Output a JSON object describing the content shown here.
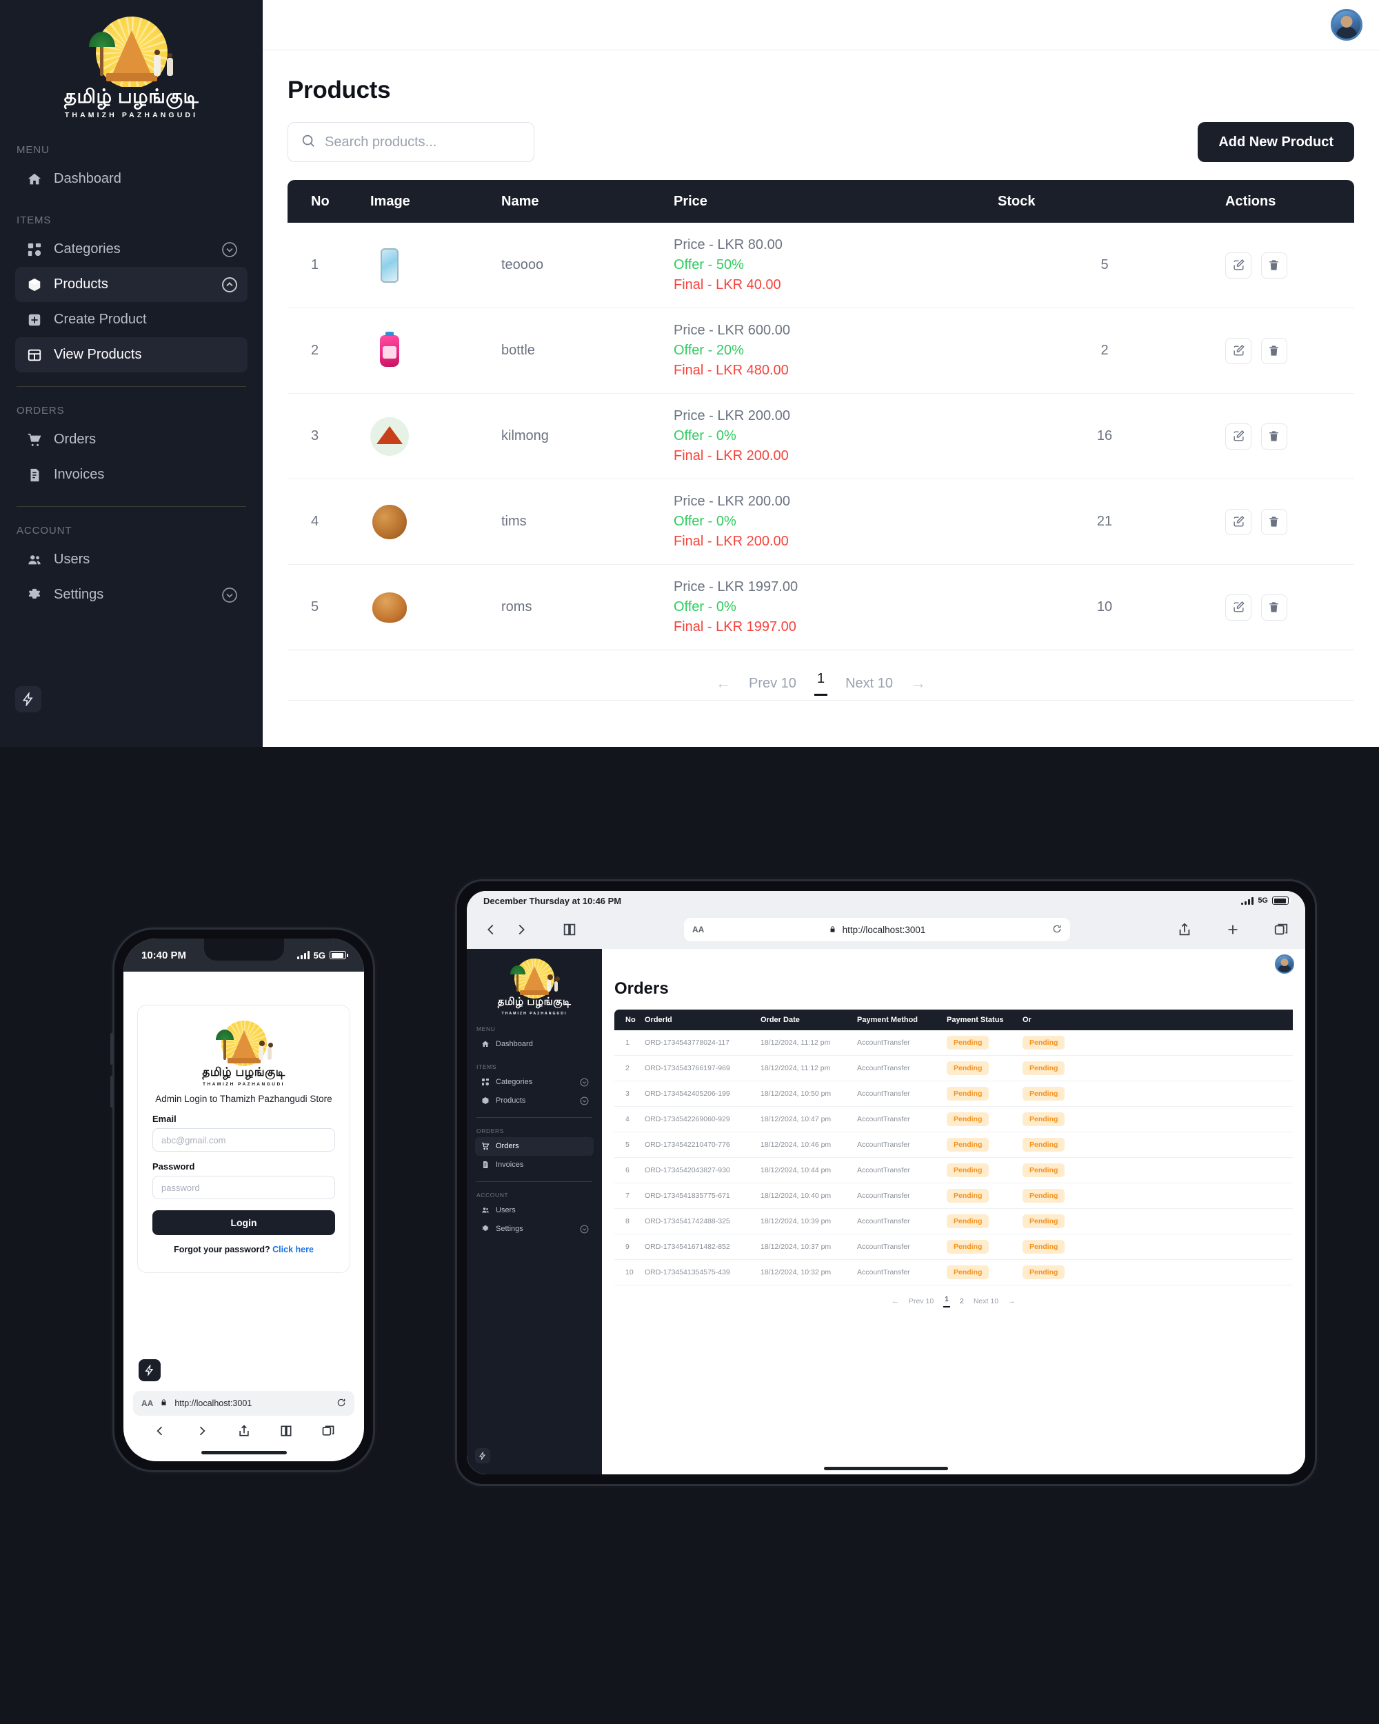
{
  "brand": {
    "tamil_name": "தமிழ் பழங்குடி",
    "latin_name": "THAMIZH PAZHANGUDI"
  },
  "desktop": {
    "sidebar": {
      "sections": [
        {
          "label": "MENU",
          "items": [
            {
              "label": "Dashboard",
              "icon": "home-icon",
              "active": false,
              "chevron": "none"
            }
          ]
        },
        {
          "label": "ITEMS",
          "items": [
            {
              "label": "Categories",
              "icon": "grid-icon",
              "active": false,
              "chevron": "down"
            },
            {
              "label": "Products",
              "icon": "box-icon",
              "active": true,
              "chevron": "up"
            },
            {
              "label": "Create Product",
              "icon": "plus-square-icon",
              "active": false,
              "chevron": "none"
            },
            {
              "label": "View Products",
              "icon": "table-icon",
              "active": true,
              "chevron": "none"
            }
          ]
        },
        {
          "label": "ORDERS",
          "items": [
            {
              "label": "Orders",
              "icon": "cart-icon",
              "active": false,
              "chevron": "none"
            },
            {
              "label": "Invoices",
              "icon": "invoice-icon",
              "active": false,
              "chevron": "none"
            }
          ]
        },
        {
          "label": "ACCOUNT",
          "items": [
            {
              "label": "Users",
              "icon": "users-icon",
              "active": false,
              "chevron": "none"
            },
            {
              "label": "Settings",
              "icon": "gear-icon",
              "active": false,
              "chevron": "down"
            }
          ]
        }
      ]
    },
    "page_title": "Products",
    "search_placeholder": "Search products...",
    "add_button": "Add New Product",
    "table": {
      "headers": [
        "No",
        "Image",
        "Name",
        "Price",
        "Stock",
        "Actions"
      ],
      "rows": [
        {
          "no": "1",
          "image": "phone-thumbnail",
          "name": "teoooo",
          "price": "Price - LKR 80.00",
          "offer": "Offer - 50%",
          "final": "Final - LKR 40.00",
          "stock": "5"
        },
        {
          "no": "2",
          "image": "bottle-thumbnail",
          "name": "bottle",
          "price": "Price - LKR 600.00",
          "offer": "Offer - 20%",
          "final": "Final - LKR 480.00",
          "stock": "2"
        },
        {
          "no": "3",
          "image": "spice-thumbnail",
          "name": "kilmong",
          "price": "Price - LKR 200.00",
          "offer": "Offer - 0%",
          "final": "Final - LKR 200.00",
          "stock": "16"
        },
        {
          "no": "4",
          "image": "cookie-thumbnail",
          "name": "tims",
          "price": "Price - LKR 200.00",
          "offer": "Offer - 0%",
          "final": "Final - LKR 200.00",
          "stock": "21"
        },
        {
          "no": "5",
          "image": "bread-thumbnail",
          "name": "roms",
          "price": "Price - LKR 1997.00",
          "offer": "Offer - 0%",
          "final": "Final - LKR 1997.00",
          "stock": "10"
        }
      ]
    },
    "pagination": {
      "prev": "Prev 10",
      "pages": [
        "1"
      ],
      "next": "Next 10"
    },
    "colors": {
      "offer": "#2ecc5e",
      "final": "#f4443c",
      "dark": "#1b1f2a"
    }
  },
  "phone": {
    "status": {
      "time": "10:40 PM",
      "network": "5G"
    },
    "login": {
      "subtitle": "Admin Login to Thamizh Pazhangudi Store",
      "email_label": "Email",
      "email_placeholder": "abc@gmail.com",
      "password_label": "Password",
      "password_placeholder": "password",
      "login_button": "Login",
      "forgot_text": "Forgot your password?",
      "forgot_link": "Click here"
    },
    "url": "http://localhost:3001",
    "aa": "AA"
  },
  "tablet": {
    "status": {
      "datetime": "December Thursday at 10:46 PM",
      "network": "5G"
    },
    "url": "http://localhost:3001",
    "aa": "AA",
    "sidebar": {
      "sections": [
        {
          "label": "MENU",
          "items": [
            {
              "label": "Dashboard",
              "icon": "home-icon",
              "active": false,
              "chevron": "none"
            }
          ]
        },
        {
          "label": "ITEMS",
          "items": [
            {
              "label": "Categories",
              "icon": "grid-icon",
              "active": false,
              "chevron": "down"
            },
            {
              "label": "Products",
              "icon": "box-icon",
              "active": false,
              "chevron": "down"
            }
          ]
        },
        {
          "label": "ORDERS",
          "items": [
            {
              "label": "Orders",
              "icon": "cart-icon",
              "active": true,
              "chevron": "none"
            },
            {
              "label": "Invoices",
              "icon": "invoice-icon",
              "active": false,
              "chevron": "none"
            }
          ]
        },
        {
          "label": "ACCOUNT",
          "items": [
            {
              "label": "Users",
              "icon": "users-icon",
              "active": false,
              "chevron": "none"
            },
            {
              "label": "Settings",
              "icon": "gear-icon",
              "active": false,
              "chevron": "down"
            }
          ]
        }
      ]
    },
    "page_title": "Orders",
    "table": {
      "headers": [
        "No",
        "OrderId",
        "Order Date",
        "Payment Method",
        "Payment Status",
        "Or"
      ],
      "rows": [
        {
          "no": "1",
          "order_id": "ORD-1734543778024-117",
          "date": "18/12/2024, 11:12 pm",
          "method": "AccountTransfer",
          "status": "Pending"
        },
        {
          "no": "2",
          "order_id": "ORD-1734543766197-969",
          "date": "18/12/2024, 11:12 pm",
          "method": "AccountTransfer",
          "status": "Pending"
        },
        {
          "no": "3",
          "order_id": "ORD-1734542405206-199",
          "date": "18/12/2024, 10:50 pm",
          "method": "AccountTransfer",
          "status": "Pending"
        },
        {
          "no": "4",
          "order_id": "ORD-1734542269060-929",
          "date": "18/12/2024, 10:47 pm",
          "method": "AccountTransfer",
          "status": "Pending"
        },
        {
          "no": "5",
          "order_id": "ORD-1734542210470-776",
          "date": "18/12/2024, 10:46 pm",
          "method": "AccountTransfer",
          "status": "Pending"
        },
        {
          "no": "6",
          "order_id": "ORD-1734542043827-930",
          "date": "18/12/2024, 10:44 pm",
          "method": "AccountTransfer",
          "status": "Pending"
        },
        {
          "no": "7",
          "order_id": "ORD-1734541835775-671",
          "date": "18/12/2024, 10:40 pm",
          "method": "AccountTransfer",
          "status": "Pending"
        },
        {
          "no": "8",
          "order_id": "ORD-1734541742488-325",
          "date": "18/12/2024, 10:39 pm",
          "method": "AccountTransfer",
          "status": "Pending"
        },
        {
          "no": "9",
          "order_id": "ORD-1734541671482-852",
          "date": "18/12/2024, 10:37 pm",
          "method": "AccountTransfer",
          "status": "Pending"
        },
        {
          "no": "10",
          "order_id": "ORD-1734541354575-439",
          "date": "18/12/2024, 10:32 pm",
          "method": "AccountTransfer",
          "status": "Pending"
        }
      ]
    },
    "pagination": {
      "prev": "Prev 10",
      "pages": [
        "1",
        "2"
      ],
      "next": "Next 10"
    },
    "colors": {
      "pending_text": "#f59220",
      "pending_bg": "#ffeccc"
    }
  }
}
